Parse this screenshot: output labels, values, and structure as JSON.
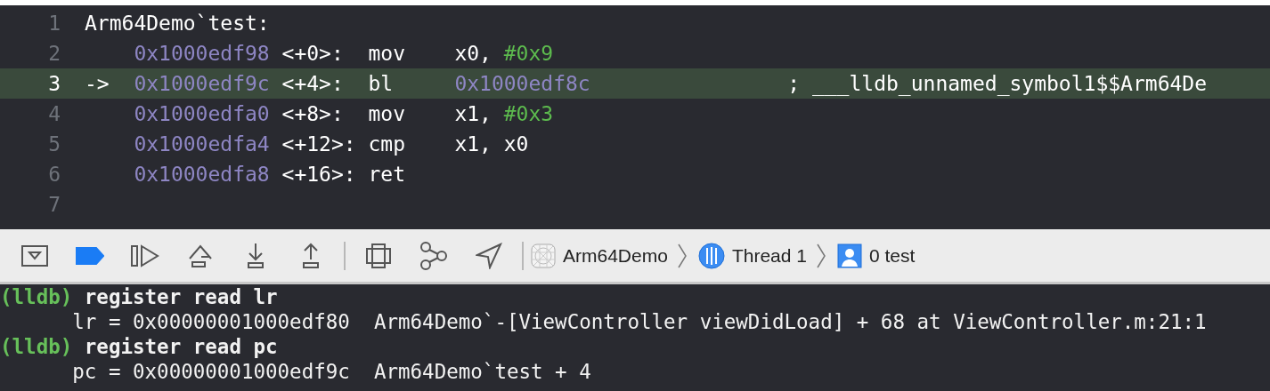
{
  "disassembly": {
    "lines": [
      {
        "number": "1",
        "kind": "label",
        "current": false,
        "text": "Arm64Demo`test:"
      },
      {
        "number": "2",
        "kind": "instruction",
        "current": false,
        "address": "0x1000edf98",
        "offset": "<+0>:",
        "mnemonic": "mov",
        "operands": [
          {
            "text": "x0, ",
            "kind": "register"
          },
          {
            "text": "#0x9",
            "kind": "immediate"
          }
        ]
      },
      {
        "number": "3",
        "kind": "instruction",
        "current": true,
        "arrow": "->",
        "address": "0x1000edf9c",
        "offset": "<+4>:",
        "mnemonic": "bl",
        "operands": [
          {
            "text": "0x1000edf8c",
            "kind": "address"
          }
        ],
        "comment": "; ___lldb_unnamed_symbol1$$Arm64De"
      },
      {
        "number": "4",
        "kind": "instruction",
        "current": false,
        "address": "0x1000edfa0",
        "offset": "<+8>:",
        "mnemonic": "mov",
        "operands": [
          {
            "text": "x1, ",
            "kind": "register"
          },
          {
            "text": "#0x3",
            "kind": "immediate"
          }
        ]
      },
      {
        "number": "5",
        "kind": "instruction",
        "current": false,
        "address": "0x1000edfa4",
        "offset": "<+12>:",
        "mnemonic": "cmp",
        "operands": [
          {
            "text": "x1, x0",
            "kind": "register"
          }
        ]
      },
      {
        "number": "6",
        "kind": "instruction",
        "current": false,
        "address": "0x1000edfa8",
        "offset": "<+16>:",
        "mnemonic": "ret"
      },
      {
        "number": "7",
        "kind": "empty",
        "current": false
      }
    ]
  },
  "debug_bar": {
    "breakpoints_active": true,
    "breadcrumbs": [
      {
        "kind": "app",
        "label": "Arm64Demo"
      },
      {
        "kind": "thread",
        "label": "Thread 1"
      },
      {
        "kind": "frame",
        "label": "0 test"
      }
    ]
  },
  "console": {
    "lines": [
      {
        "kind": "command",
        "prompt": "(lldb)",
        "text": "register read lr"
      },
      {
        "kind": "output",
        "text": "lr = 0x00000001000edf80  Arm64Demo`-[ViewController viewDidLoad] + 68 at ViewController.m:21:1"
      },
      {
        "kind": "command",
        "prompt": "(lldb)",
        "text": "register read pc"
      },
      {
        "kind": "output",
        "text": "pc = 0x00000001000edf9c  Arm64Demo`test + 4"
      }
    ]
  }
}
